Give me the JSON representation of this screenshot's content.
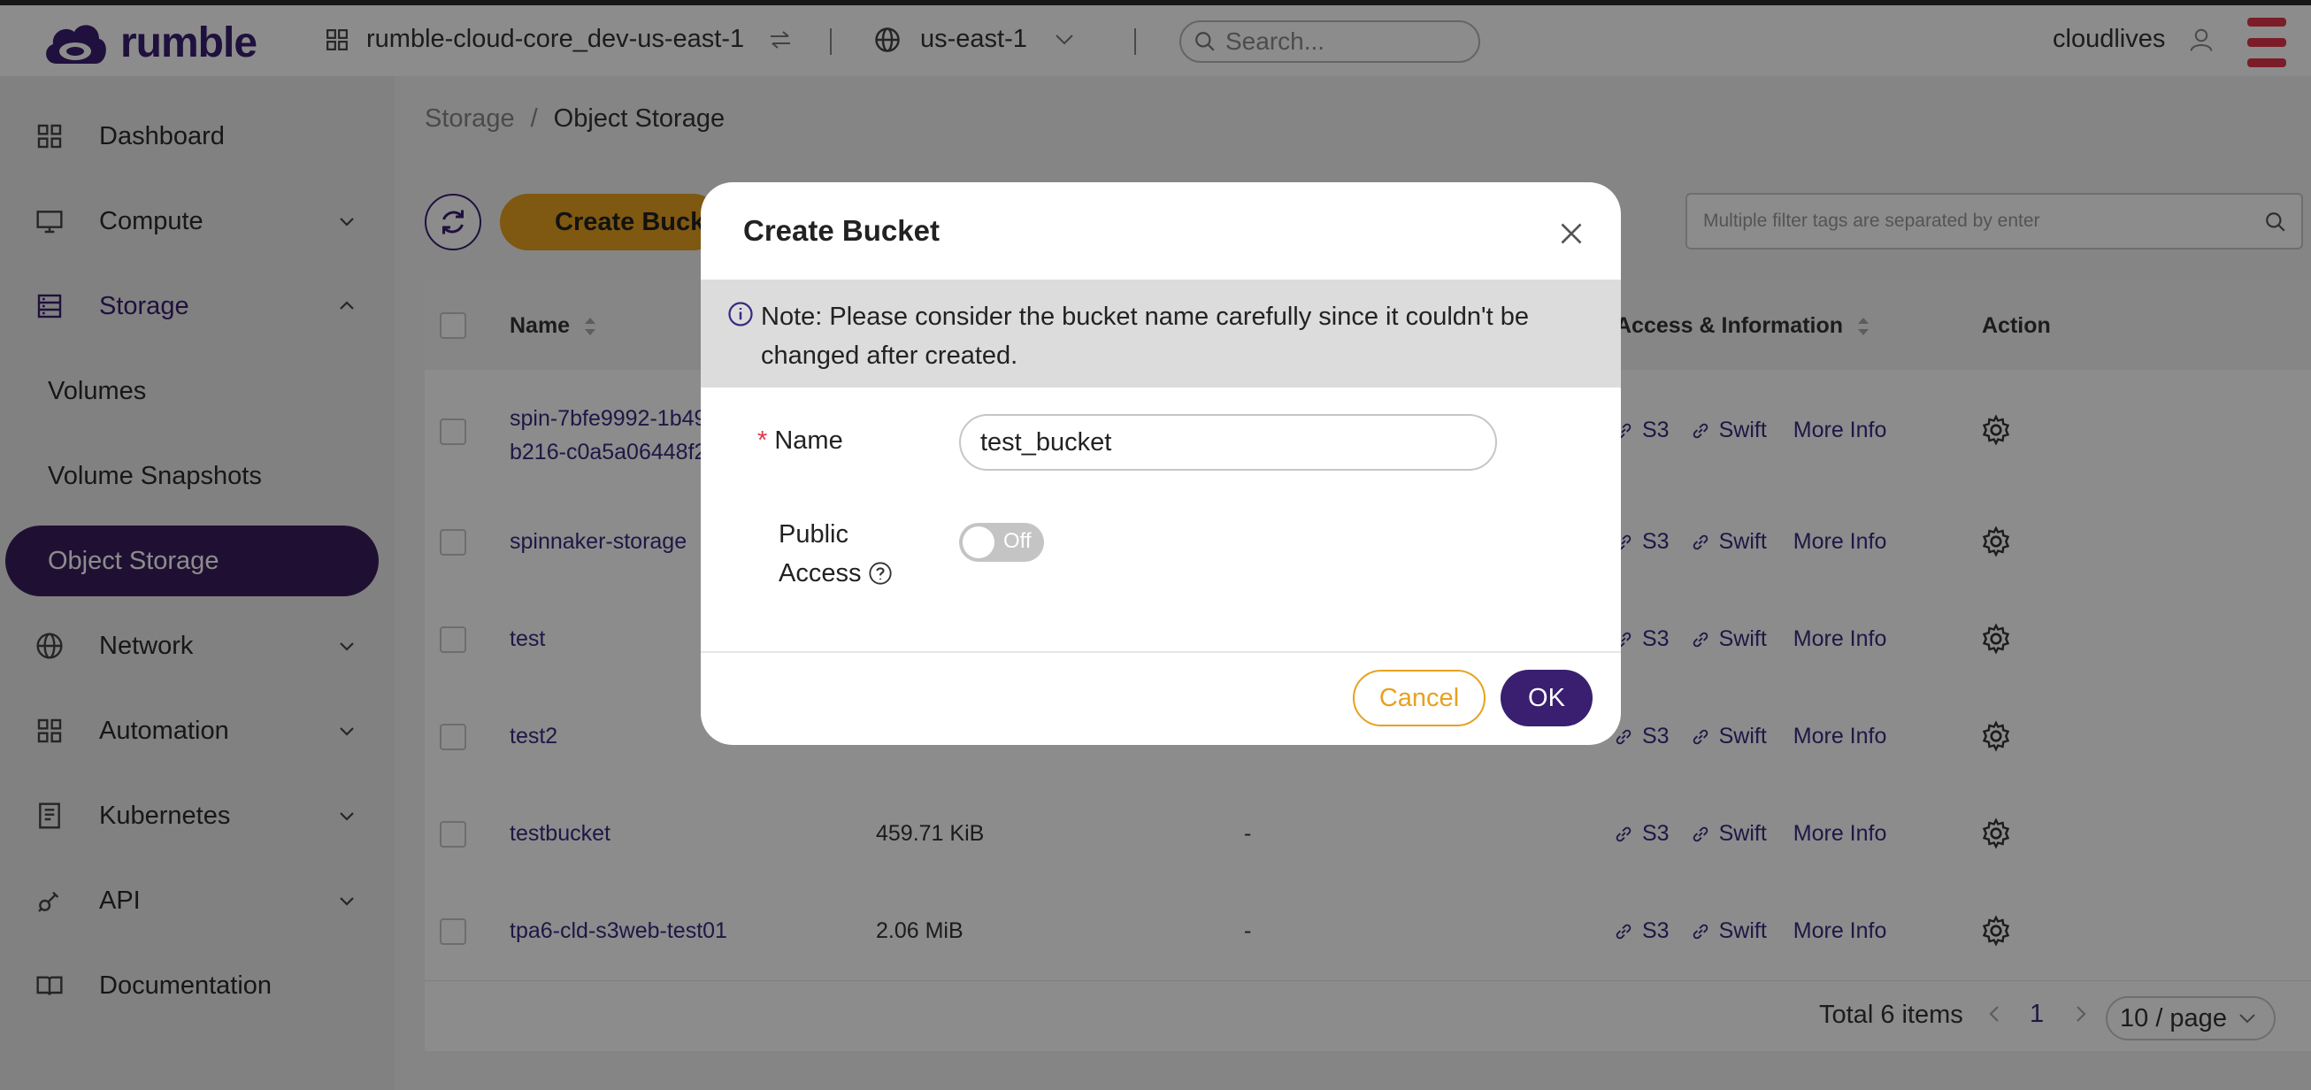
{
  "header": {
    "brand": "rumble",
    "project": "rumble-cloud-core_dev-us-east-1",
    "region": "us-east-1",
    "search_placeholder": "Search...",
    "user": "cloudlives"
  },
  "sidebar": {
    "items": [
      {
        "label": "Dashboard"
      },
      {
        "label": "Compute"
      },
      {
        "label": "Storage"
      },
      {
        "label": "Network"
      },
      {
        "label": "Automation"
      },
      {
        "label": "Kubernetes"
      },
      {
        "label": "API"
      },
      {
        "label": "Documentation"
      }
    ],
    "storage_sub": [
      {
        "label": "Volumes"
      },
      {
        "label": "Volume Snapshots"
      },
      {
        "label": "Object Storage"
      }
    ]
  },
  "breadcrumb": {
    "parent": "Storage",
    "separator": "/",
    "current": "Object Storage"
  },
  "toolbar": {
    "create_label": "Create Bucket",
    "filter_placeholder": "Multiple filter tags are separated by enter"
  },
  "table": {
    "headers": {
      "name": "Name",
      "access": "Access & Information",
      "action": "Action"
    },
    "rows": [
      {
        "name_line1": "spin-7bfe9992-1b49",
        "name_line2": "b216-c0a5a06448f2",
        "size": "",
        "extra": ""
      },
      {
        "name_line1": "spinnaker-storage",
        "size": "",
        "extra": ""
      },
      {
        "name_line1": "test",
        "size": "",
        "extra": ""
      },
      {
        "name_line1": "test2",
        "size": "",
        "extra": ""
      },
      {
        "name_line1": "testbucket",
        "size": "459.71 KiB",
        "extra": "-"
      },
      {
        "name_line1": "tpa6-cld-s3web-test01",
        "size": "2.06 MiB",
        "extra": "-"
      }
    ],
    "access_links": {
      "s3": "S3",
      "swift": "Swift",
      "more": "More Info"
    }
  },
  "pagination": {
    "total": "Total 6 items",
    "page": "1",
    "page_size": "10 / page"
  },
  "modal": {
    "title": "Create Bucket",
    "note": "Note: Please consider the bucket name carefully since it couldn't be changed after created.",
    "name_label": "Name",
    "required_mark": "*",
    "name_value": "test_bucket",
    "public_label_line1": "Public",
    "public_label_line2": "Access",
    "public_toggle": "Off",
    "cancel_label": "Cancel",
    "ok_label": "OK"
  },
  "colors": {
    "brand": "#3a1e70",
    "accent": "#e7a11f",
    "danger": "#e0364a"
  }
}
